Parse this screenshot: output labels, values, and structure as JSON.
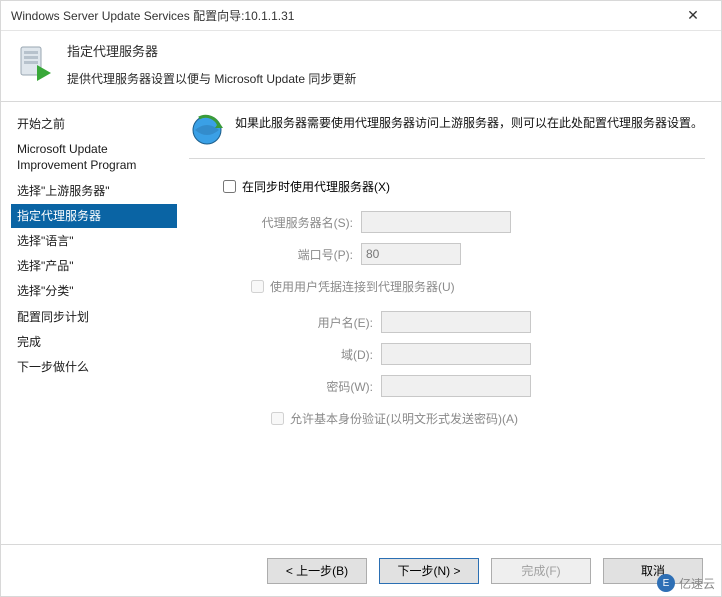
{
  "titlebar": {
    "title": "Windows Server Update Services 配置向导:10.1.1.31"
  },
  "header": {
    "title": "指定代理服务器",
    "subtitle": "提供代理服务器设置以便与 Microsoft Update 同步更新"
  },
  "sidebar": {
    "items": [
      {
        "label": "开始之前"
      },
      {
        "label": "Microsoft Update Improvement Program"
      },
      {
        "label": "选择\"上游服务器\""
      },
      {
        "label": "指定代理服务器",
        "selected": true
      },
      {
        "label": "选择\"语言\""
      },
      {
        "label": "选择\"产品\""
      },
      {
        "label": "选择\"分类\""
      },
      {
        "label": "配置同步计划"
      },
      {
        "label": "完成"
      },
      {
        "label": "下一步做什么"
      }
    ]
  },
  "main": {
    "description": "如果此服务器需要使用代理服务器访问上游服务器，则可以在此处配置代理服务器设置。",
    "useProxyLabel": "在同步时使用代理服务器(X)",
    "useProxyChecked": false,
    "proxyNameLabel": "代理服务器名(S):",
    "proxyNameValue": "",
    "portLabel": "端口号(P):",
    "portValue": "80",
    "useCredsLabel": "使用用户凭据连接到代理服务器(U)",
    "useCredsChecked": false,
    "userLabel": "用户名(E):",
    "userValue": "",
    "domainLabel": "域(D):",
    "domainValue": "",
    "passwordLabel": "密码(W):",
    "passwordValue": "",
    "basicAuthLabel": "允许基本身份验证(以明文形式发送密码)(A)",
    "basicAuthChecked": false
  },
  "footer": {
    "back": "< 上一步(B)",
    "next": "下一步(N) >",
    "finish": "完成(F)",
    "cancel": "取消"
  },
  "watermark": "亿速云"
}
